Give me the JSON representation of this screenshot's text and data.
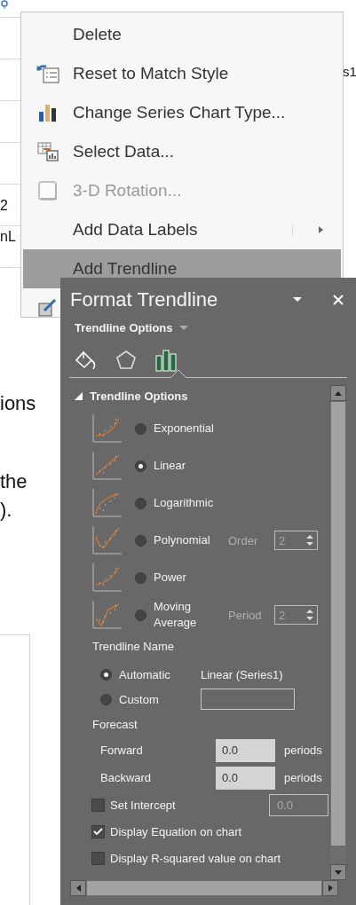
{
  "background": {
    "legend_fragment": "s1",
    "axis_fragment": "2",
    "label_fragment": "nL",
    "text_lines": [
      "ions",
      "the",
      ")."
    ]
  },
  "menu": {
    "items": [
      {
        "kind": "plain",
        "label": "Delete",
        "disabled": false,
        "selected": false,
        "submenu": false
      },
      {
        "kind": "reset",
        "label": "Reset to Match Style",
        "disabled": false,
        "selected": false,
        "submenu": false
      },
      {
        "kind": "chart-type",
        "label": "Change Series Chart Type...",
        "disabled": false,
        "selected": false,
        "submenu": false
      },
      {
        "kind": "select-data",
        "label": "Select Data...",
        "disabled": false,
        "selected": false,
        "submenu": false
      },
      {
        "kind": "rotation",
        "label": "3-D Rotation...",
        "disabled": true,
        "selected": false,
        "submenu": false
      },
      {
        "kind": "plain",
        "label": "Add Data Labels",
        "disabled": false,
        "selected": false,
        "submenu": true
      },
      {
        "kind": "plain",
        "label": "Add Trendline",
        "disabled": false,
        "selected": true,
        "submenu": false
      },
      {
        "kind": "format",
        "disabled": false,
        "selected": false
      }
    ]
  },
  "pane": {
    "title": "Format Trendline",
    "options_menu": "Trendline Options",
    "tabs": [
      {
        "kind": "fill",
        "selected": false
      },
      {
        "kind": "effects",
        "selected": false
      },
      {
        "kind": "options",
        "selected": true
      }
    ],
    "section": {
      "title": "Trendline Options",
      "expanded": true
    },
    "types": [
      {
        "kind": "exponential",
        "label": "Exponential",
        "selected": false
      },
      {
        "kind": "linear",
        "label": "Linear",
        "selected": true
      },
      {
        "kind": "logarithmic",
        "label": "Logarithmic",
        "selected": false
      },
      {
        "kind": "polynomial",
        "label": "Polynomial",
        "selected": false,
        "param_label": "Order",
        "param_value": "2"
      },
      {
        "kind": "power",
        "label": "Power",
        "selected": false
      },
      {
        "kind": "moving-average",
        "label": "Moving Average",
        "selected": false,
        "param_label": "Period",
        "param_value": "2"
      }
    ],
    "name_heading": "Trendline Name",
    "name_options": [
      {
        "label": "Automatic",
        "selected": true,
        "value": "Linear (Series1)"
      },
      {
        "label": "Custom",
        "selected": false
      }
    ],
    "forecast_heading": "Forecast",
    "forecast": [
      {
        "label": "Forward",
        "value": "0.0",
        "unit": "periods"
      },
      {
        "label": "Backward",
        "value": "0.0",
        "unit": "periods"
      }
    ],
    "checks": [
      {
        "label": "Set Intercept",
        "checked": false,
        "value": "0.0"
      },
      {
        "label": "Display Equation on chart",
        "checked": true
      },
      {
        "label": "Display R-squared value on chart",
        "checked": false
      }
    ]
  }
}
